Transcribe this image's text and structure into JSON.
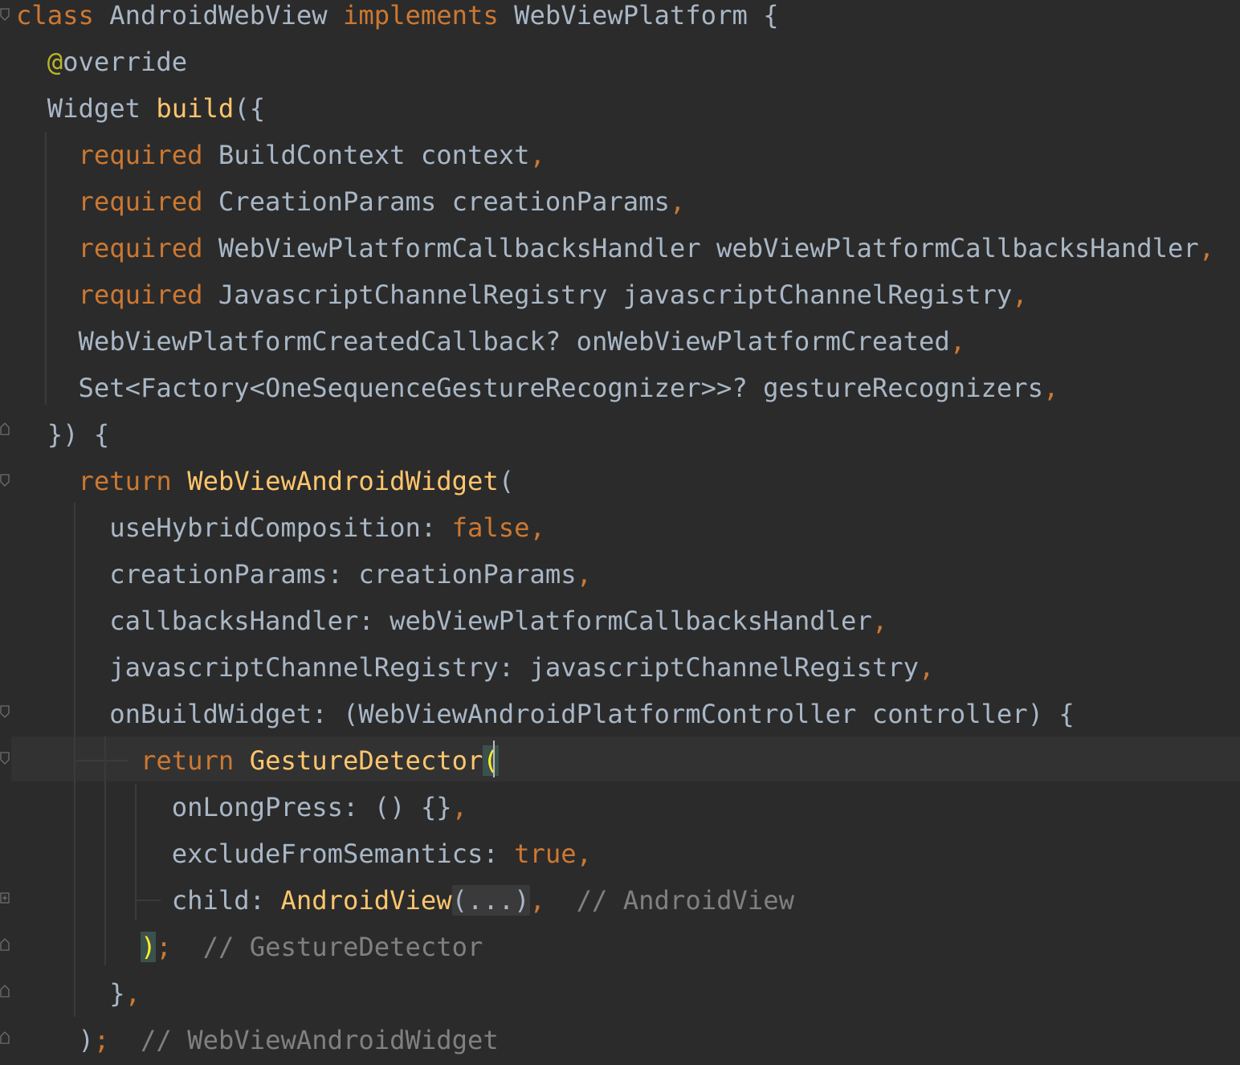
{
  "editor": {
    "language": "Dart",
    "colors": {
      "background": "#2B2B2B",
      "current_line": "#323232",
      "keyword": "#CC7832",
      "function": "#FFC66D",
      "annotation": "#BBB529",
      "comment": "#808080",
      "plain": "#A9B7C6",
      "brace_match_bg": "#3B514D",
      "brace_match_fg": "#FFEF28"
    },
    "lines": [
      {
        "tokens": [
          {
            "t": "class",
            "c": "kw"
          },
          {
            "t": " AndroidWebView ",
            "c": "pl"
          },
          {
            "t": "implements",
            "c": "kw"
          },
          {
            "t": " WebViewPlatform {",
            "c": "pl"
          }
        ]
      },
      {
        "tokens": [
          {
            "t": "  @",
            "c": "an"
          },
          {
            "t": "override",
            "c": "pl"
          }
        ]
      },
      {
        "tokens": [
          {
            "t": "  Widget ",
            "c": "pl"
          },
          {
            "t": "build",
            "c": "fn"
          },
          {
            "t": "({",
            "c": "pl"
          }
        ]
      },
      {
        "tokens": [
          {
            "t": "    required",
            "c": "kw"
          },
          {
            "t": " BuildContext context",
            "c": "pl"
          },
          {
            "t": ",",
            "c": "pn"
          }
        ]
      },
      {
        "tokens": [
          {
            "t": "    required",
            "c": "kw"
          },
          {
            "t": " CreationParams creationParams",
            "c": "pl"
          },
          {
            "t": ",",
            "c": "pn"
          }
        ]
      },
      {
        "tokens": [
          {
            "t": "    required",
            "c": "kw"
          },
          {
            "t": " WebViewPlatformCallbacksHandler webViewPlatformCallbacksHandler",
            "c": "pl"
          },
          {
            "t": ",",
            "c": "pn"
          }
        ]
      },
      {
        "tokens": [
          {
            "t": "    required",
            "c": "kw"
          },
          {
            "t": " JavascriptChannelRegistry javascriptChannelRegistry",
            "c": "pl"
          },
          {
            "t": ",",
            "c": "pn"
          }
        ]
      },
      {
        "tokens": [
          {
            "t": "    WebViewPlatformCreatedCallback? onWebViewPlatformCreated",
            "c": "pl"
          },
          {
            "t": ",",
            "c": "pn"
          }
        ]
      },
      {
        "tokens": [
          {
            "t": "    Set<Factory<OneSequenceGestureRecognizer>>? gestureRecognizers",
            "c": "pl"
          },
          {
            "t": ",",
            "c": "pn"
          }
        ]
      },
      {
        "tokens": [
          {
            "t": "  }) {",
            "c": "pl"
          }
        ]
      },
      {
        "tokens": [
          {
            "t": "    return",
            "c": "kw"
          },
          {
            "t": " ",
            "c": "pl"
          },
          {
            "t": "WebViewAndroidWidget",
            "c": "fn"
          },
          {
            "t": "(",
            "c": "pl"
          }
        ]
      },
      {
        "tokens": [
          {
            "t": "      useHybridComposition: ",
            "c": "pl"
          },
          {
            "t": "false",
            "c": "kw"
          },
          {
            "t": ",",
            "c": "pn"
          }
        ]
      },
      {
        "tokens": [
          {
            "t": "      creationParams: creationParams",
            "c": "pl"
          },
          {
            "t": ",",
            "c": "pn"
          }
        ]
      },
      {
        "tokens": [
          {
            "t": "      callbacksHandler: webViewPlatformCallbacksHandler",
            "c": "pl"
          },
          {
            "t": ",",
            "c": "pn"
          }
        ]
      },
      {
        "tokens": [
          {
            "t": "      javascriptChannelRegistry: javascriptChannelRegistry",
            "c": "pl"
          },
          {
            "t": ",",
            "c": "pn"
          }
        ]
      },
      {
        "tokens": [
          {
            "t": "      onBuildWidget: (WebViewAndroidPlatformController controller) {",
            "c": "pl"
          }
        ]
      },
      {
        "tokens": [
          {
            "t": "        return",
            "c": "kw"
          },
          {
            "t": " ",
            "c": "pl"
          },
          {
            "t": "GestureDetector",
            "c": "fn"
          },
          {
            "t": "(",
            "c": "bm"
          }
        ]
      },
      {
        "tokens": [
          {
            "t": "          onLongPress: () {}",
            "c": "pl"
          },
          {
            "t": ",",
            "c": "pn"
          }
        ]
      },
      {
        "tokens": [
          {
            "t": "          excludeFromSemantics: ",
            "c": "pl"
          },
          {
            "t": "true",
            "c": "kw"
          },
          {
            "t": ",",
            "c": "pn"
          }
        ]
      },
      {
        "tokens": [
          {
            "t": "          child: ",
            "c": "pl"
          },
          {
            "t": "AndroidView",
            "c": "fn"
          },
          {
            "t": "(...)",
            "c": "fd"
          },
          {
            "t": ",",
            "c": "pn"
          },
          {
            "t": "  // AndroidView",
            "c": "cm"
          }
        ]
      },
      {
        "tokens": [
          {
            "t": "        ",
            "c": "pl"
          },
          {
            "t": ")",
            "c": "bm"
          },
          {
            "t": ";",
            "c": "pn"
          },
          {
            "t": "  // GestureDetector",
            "c": "cm"
          }
        ]
      },
      {
        "tokens": [
          {
            "t": "      }",
            "c": "pl"
          },
          {
            "t": ",",
            "c": "pn"
          }
        ]
      },
      {
        "tokens": [
          {
            "t": "    )",
            "c": "pl"
          },
          {
            "t": ";",
            "c": "pn"
          },
          {
            "t": "  // WebViewAndroidWidget",
            "c": "cm"
          }
        ]
      }
    ]
  }
}
